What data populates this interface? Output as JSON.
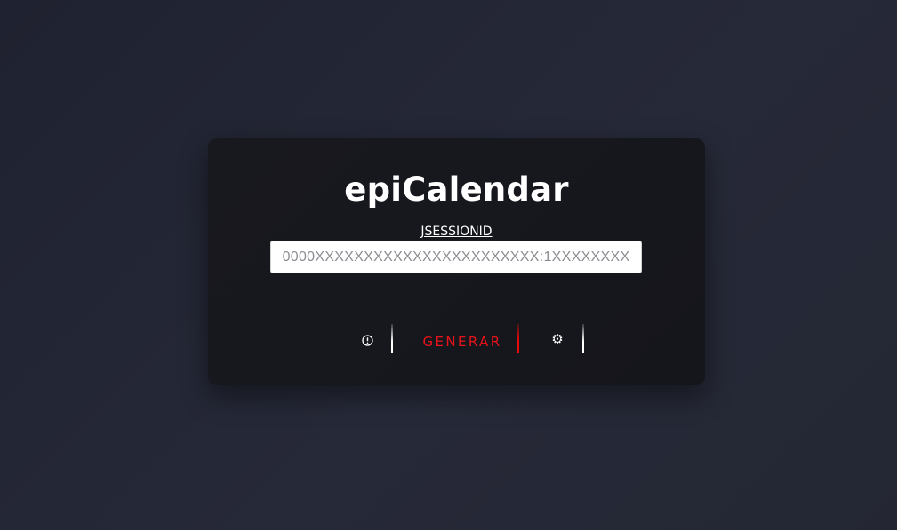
{
  "app": {
    "title": "epiCalendar"
  },
  "session": {
    "label": "JSESSIONID",
    "placeholder": "0000XXXXXXXXXXXXXXXXXXXXXXX:1XXXXXXXX",
    "value": ""
  },
  "actions": {
    "info_icon": "info-circle-icon",
    "generate_label": "GENERAR",
    "settings_icon": "gear-icon",
    "settings_glyph": "⚙"
  },
  "colors": {
    "accent": "#e8131a",
    "card": "#16171c",
    "background": "#242733",
    "text": "#ffffff"
  }
}
